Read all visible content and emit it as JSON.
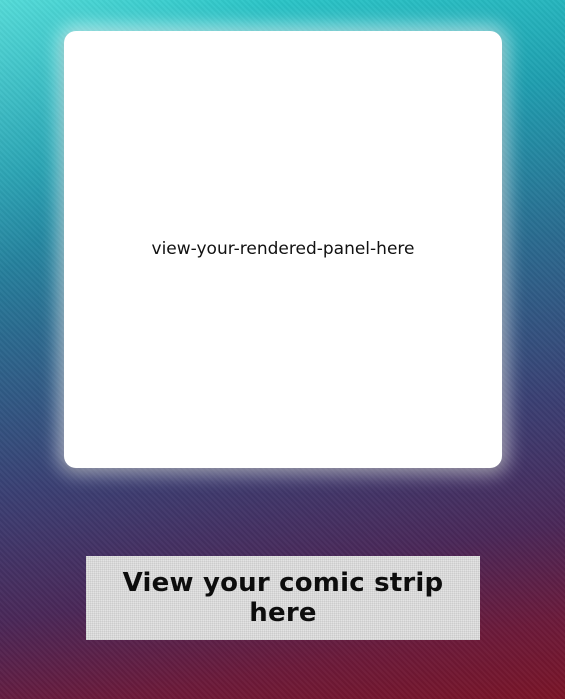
{
  "panel": {
    "placeholder_text": "view-your-rendered-panel-here"
  },
  "comic_strip_button": {
    "label": "View your comic strip here"
  },
  "colors": {
    "background_top": "#2fd3d0",
    "background_bottom": "#7a1426",
    "panel_background": "#ffffff",
    "button_background": "#e3e3e3"
  }
}
